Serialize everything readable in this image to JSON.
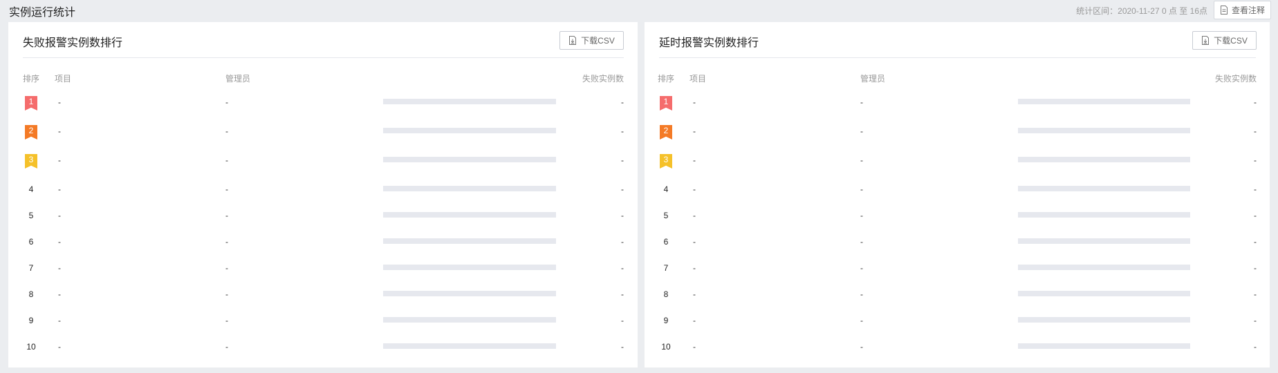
{
  "header": {
    "title": "实例运行统计",
    "period": "统计区间：2020-11-27 0 点 至 16点",
    "notes_button": "查看注释"
  },
  "panels": [
    {
      "title": "失败报警实例数排行",
      "csv_button": "下载CSV",
      "columns": {
        "rank": "排序",
        "project": "项目",
        "admin": "管理员",
        "count": "失败实例数"
      },
      "rows": [
        {
          "rank": "1",
          "project": "-",
          "admin": "-",
          "count": "-"
        },
        {
          "rank": "2",
          "project": "-",
          "admin": "-",
          "count": "-"
        },
        {
          "rank": "3",
          "project": "-",
          "admin": "-",
          "count": "-"
        },
        {
          "rank": "4",
          "project": "-",
          "admin": "-",
          "count": "-"
        },
        {
          "rank": "5",
          "project": "-",
          "admin": "-",
          "count": "-"
        },
        {
          "rank": "6",
          "project": "-",
          "admin": "-",
          "count": "-"
        },
        {
          "rank": "7",
          "project": "-",
          "admin": "-",
          "count": "-"
        },
        {
          "rank": "8",
          "project": "-",
          "admin": "-",
          "count": "-"
        },
        {
          "rank": "9",
          "project": "-",
          "admin": "-",
          "count": "-"
        },
        {
          "rank": "10",
          "project": "-",
          "admin": "-",
          "count": "-"
        }
      ]
    },
    {
      "title": "延时报警实例数排行",
      "csv_button": "下载CSV",
      "columns": {
        "rank": "排序",
        "project": "项目",
        "admin": "管理员",
        "count": "失败实例数"
      },
      "rows": [
        {
          "rank": "1",
          "project": "-",
          "admin": "-",
          "count": "-"
        },
        {
          "rank": "2",
          "project": "-",
          "admin": "-",
          "count": "-"
        },
        {
          "rank": "3",
          "project": "-",
          "admin": "-",
          "count": "-"
        },
        {
          "rank": "4",
          "project": "-",
          "admin": "-",
          "count": "-"
        },
        {
          "rank": "5",
          "project": "-",
          "admin": "-",
          "count": "-"
        },
        {
          "rank": "6",
          "project": "-",
          "admin": "-",
          "count": "-"
        },
        {
          "rank": "7",
          "project": "-",
          "admin": "-",
          "count": "-"
        },
        {
          "rank": "8",
          "project": "-",
          "admin": "-",
          "count": "-"
        },
        {
          "rank": "9",
          "project": "-",
          "admin": "-",
          "count": "-"
        },
        {
          "rank": "10",
          "project": "-",
          "admin": "-",
          "count": "-"
        }
      ]
    }
  ],
  "rank_badge_colors": [
    "#f56c6c",
    "#f47a26",
    "#f5c12a"
  ],
  "bar_color": "#e6e8ee",
  "icons": {
    "notes": "document-icon",
    "csv": "download-file-icon"
  }
}
